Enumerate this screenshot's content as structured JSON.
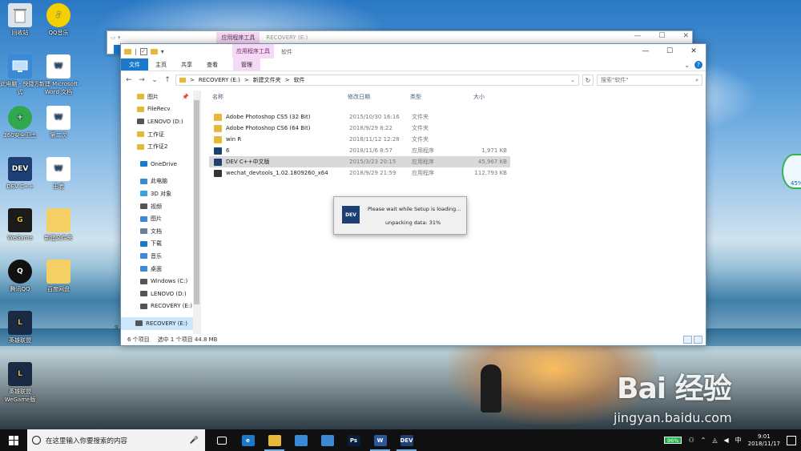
{
  "desktop_icons": [
    {
      "label": "回收站",
      "icon": "recycle-bin-icon"
    },
    {
      "label": "QQ音乐",
      "icon": "qq-music-icon"
    },
    {
      "label": "此电脑 - 快捷方式",
      "icon": "computer-icon"
    },
    {
      "label": "新建 Microsoft Word 文档",
      "icon": "word-doc-icon"
    },
    {
      "label": "360安全卫士",
      "icon": "security-icon"
    },
    {
      "label": "第二次",
      "icon": "word-doc-icon"
    },
    {
      "label": "DEV C++",
      "icon": "dev-cpp-icon"
    },
    {
      "label": "王老",
      "icon": "word-doc-icon"
    },
    {
      "label": "WeGame",
      "icon": "wegame-icon"
    },
    {
      "label": "新建文件夹",
      "icon": "folder-icon"
    },
    {
      "label": "腾讯QQ",
      "icon": "qq-icon"
    },
    {
      "label": "百度网盘",
      "icon": "folder-icon"
    },
    {
      "label": "英雄联盟",
      "icon": "lol-icon"
    },
    {
      "label": "英雄联盟 WeGame版",
      "icon": "lol-icon"
    }
  ],
  "back_window": {
    "context_tab": "应用程序工具",
    "title": "RECOVERY (E:)"
  },
  "window": {
    "context_tab": "应用程序工具",
    "title": "软件",
    "ribbon_tabs": [
      "文件",
      "主页",
      "共享",
      "查看",
      "管理"
    ],
    "address": {
      "crumbs": [
        "RECOVERY (E:)",
        "新建文件夹",
        "软件"
      ],
      "separator": ">"
    },
    "search_placeholder": "搜索\"软件\"",
    "nav_items": [
      {
        "label": "图片",
        "icon": "folder-icon",
        "color": "#e7b93b"
      },
      {
        "label": "FileRecv",
        "icon": "folder-icon",
        "color": "#e7b93b"
      },
      {
        "label": "LENOVO (D:)",
        "icon": "drive-icon",
        "color": "#555555"
      },
      {
        "label": "工作证",
        "icon": "folder-icon",
        "color": "#e7b93b"
      },
      {
        "label": "工作证2",
        "icon": "folder-icon",
        "color": "#e7b93b"
      },
      {
        "label": "OneDrive",
        "icon": "cloud-icon",
        "color": "#1979ca"
      },
      {
        "label": "此电脑",
        "icon": "computer-icon",
        "color": "#3a8ad6"
      },
      {
        "label": "3D 对象",
        "icon": "cube-icon",
        "color": "#3aa0e0"
      },
      {
        "label": "视频",
        "icon": "video-icon",
        "color": "#555555"
      },
      {
        "label": "图片",
        "icon": "picture-icon",
        "color": "#3a8ad6"
      },
      {
        "label": "文档",
        "icon": "document-icon",
        "color": "#6d7f95"
      },
      {
        "label": "下载",
        "icon": "download-icon",
        "color": "#1979ca"
      },
      {
        "label": "音乐",
        "icon": "music-icon",
        "color": "#3a8ad6"
      },
      {
        "label": "桌面",
        "icon": "desktop-icon",
        "color": "#3a8ad6"
      },
      {
        "label": "Windows (C:)",
        "icon": "drive-icon",
        "color": "#555555"
      },
      {
        "label": "LENOVO (D:)",
        "icon": "drive-icon",
        "color": "#555555"
      },
      {
        "label": "RECOVERY (E:)",
        "icon": "drive-icon",
        "color": "#555555"
      },
      {
        "label": "RECOVERY (E:)",
        "icon": "drive-icon",
        "color": "#555555"
      }
    ],
    "columns": [
      "名称",
      "修改日期",
      "类型",
      "大小"
    ],
    "files": [
      {
        "name": "Adobe Photoshop CS5 (32 Bit)",
        "date": "2015/10/30 16:16",
        "type": "文件夹",
        "size": "",
        "icon": "folder-icon",
        "color": "#e7b93b"
      },
      {
        "name": "Adobe Photoshop CS6 (64 Bit)",
        "date": "2018/9/29 8:22",
        "type": "文件夹",
        "size": "",
        "icon": "folder-icon",
        "color": "#e7b93b"
      },
      {
        "name": "win R",
        "date": "2018/11/12 12:28",
        "type": "文件夹",
        "size": "",
        "icon": "folder-icon",
        "color": "#e7b93b"
      },
      {
        "name": "6",
        "date": "2018/11/6 8:57",
        "type": "应用程序",
        "size": "1,971 KB",
        "icon": "app-icon",
        "color": "#1d3f74"
      },
      {
        "name": "DEV C++中文版",
        "date": "2015/3/23 20:15",
        "type": "应用程序",
        "size": "45,967 KB",
        "icon": "dev-cpp-icon",
        "color": "#1d3f74"
      },
      {
        "name": "wechat_devtools_1.02.1809260_x64",
        "date": "2018/9/29 21:59",
        "type": "应用程序",
        "size": "112,793 KB",
        "icon": "wechat-devtools-icon",
        "color": "#333333"
      }
    ],
    "selected_index": 4,
    "status": {
      "count": "6 个项目",
      "selection": "选中 1 个项目  44.8 MB"
    },
    "nav_overflow_number": "9"
  },
  "setup_dialog": {
    "line1": "Please wait while Setup is loading...",
    "line2": "unpacking data: 31%",
    "progress_percent": 31
  },
  "side_widget": {
    "percent": "45%"
  },
  "watermark": {
    "logo": "Bai 经验",
    "url": "jingyan.baidu.com"
  },
  "taskbar": {
    "search_placeholder": "在这里输入你要搜索的内容",
    "apps": [
      {
        "name": "task-view-icon",
        "label": "",
        "color": "#101010"
      },
      {
        "name": "edge-icon",
        "label": "e",
        "color": "#1979ca"
      },
      {
        "name": "file-explorer-icon",
        "label": "",
        "color": "#e7b93b"
      },
      {
        "name": "store-icon",
        "label": "",
        "color": "#3a8ad6"
      },
      {
        "name": "clock-app-icon",
        "label": "",
        "color": "#3a8ad6"
      },
      {
        "name": "photoshop-icon",
        "label": "Ps",
        "color": "#0a1d3a"
      },
      {
        "name": "word-icon",
        "label": "W",
        "color": "#2b579a"
      },
      {
        "name": "dev-cpp-icon",
        "label": "DEV",
        "color": "#1d3f74"
      }
    ],
    "battery": "96%",
    "time": "9:01",
    "date": "2018/11/17"
  }
}
